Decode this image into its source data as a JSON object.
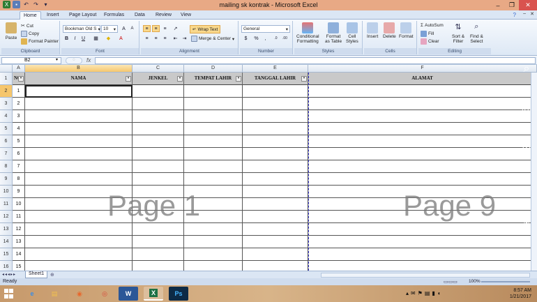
{
  "window": {
    "title": "mailing sk kontrak - Microsoft Excel"
  },
  "ribbon_tabs": [
    "Home",
    "Insert",
    "Page Layout",
    "Formulas",
    "Data",
    "Review",
    "View"
  ],
  "clipboard": {
    "paste": "Paste",
    "cut": "Cut",
    "copy": "Copy",
    "format_painter": "Format Painter",
    "label": "Clipboard"
  },
  "font": {
    "name": "Bookman Old S",
    "size": "10",
    "label": "Font"
  },
  "alignment": {
    "wrap_text": "Wrap Text",
    "merge_center": "Merge & Center",
    "label": "Alignment"
  },
  "number": {
    "format": "General",
    "label": "Number"
  },
  "styles": {
    "conditional": "Conditional",
    "formatting": "Formatting",
    "format_as": "Format",
    "as_table": "as Table",
    "cell": "Cell",
    "cell_styles": "Styles",
    "label": "Styles"
  },
  "cells": {
    "insert": "Insert",
    "delete": "Delete",
    "format": "Format",
    "label": "Cells"
  },
  "editing": {
    "autosum": "AutoSum",
    "fill": "Fill",
    "clear": "Clear",
    "sort": "Sort &",
    "filter": "Filter",
    "find": "Find &",
    "select": "Select",
    "label": "Editing"
  },
  "formula_bar": {
    "name_box": "B2",
    "fx": "fx"
  },
  "columns": [
    "A",
    "B",
    "C",
    "D",
    "E",
    "F"
  ],
  "headers": {
    "no": "NO",
    "nama": "NAMA",
    "jenkel": "JENKEL",
    "tempat_lahir": "TEMPAT LAHIR",
    "tanggal_lahir": "TANGGAL LAHIR",
    "alamat": "ALAMAT"
  },
  "row_numbers": [
    "1",
    "2",
    "3",
    "4",
    "5",
    "6",
    "7",
    "8",
    "9",
    "10",
    "11",
    "12",
    "13",
    "14",
    "15",
    "16"
  ],
  "data_numbers": [
    "1",
    "2",
    "3",
    "4",
    "5",
    "6",
    "7",
    "8",
    "9",
    "10",
    "11",
    "12",
    "13",
    "14",
    "15"
  ],
  "watermarks": {
    "page1": "Page 1",
    "page9": "Page 9"
  },
  "sheet": {
    "tab": "Sheet1"
  },
  "status": {
    "ready": "Ready",
    "zoom": "100%"
  },
  "clock": {
    "time": "8:57 AM",
    "date": "1/21/2017"
  },
  "taskbar_apps": [
    "ie",
    "explorer",
    "firefox",
    "chrome",
    "word",
    "excel",
    "photoshop"
  ],
  "colors": {
    "title_bar": "#e8a985",
    "selected_header": "#f6c66c",
    "page_break": "#3b3bd6"
  }
}
